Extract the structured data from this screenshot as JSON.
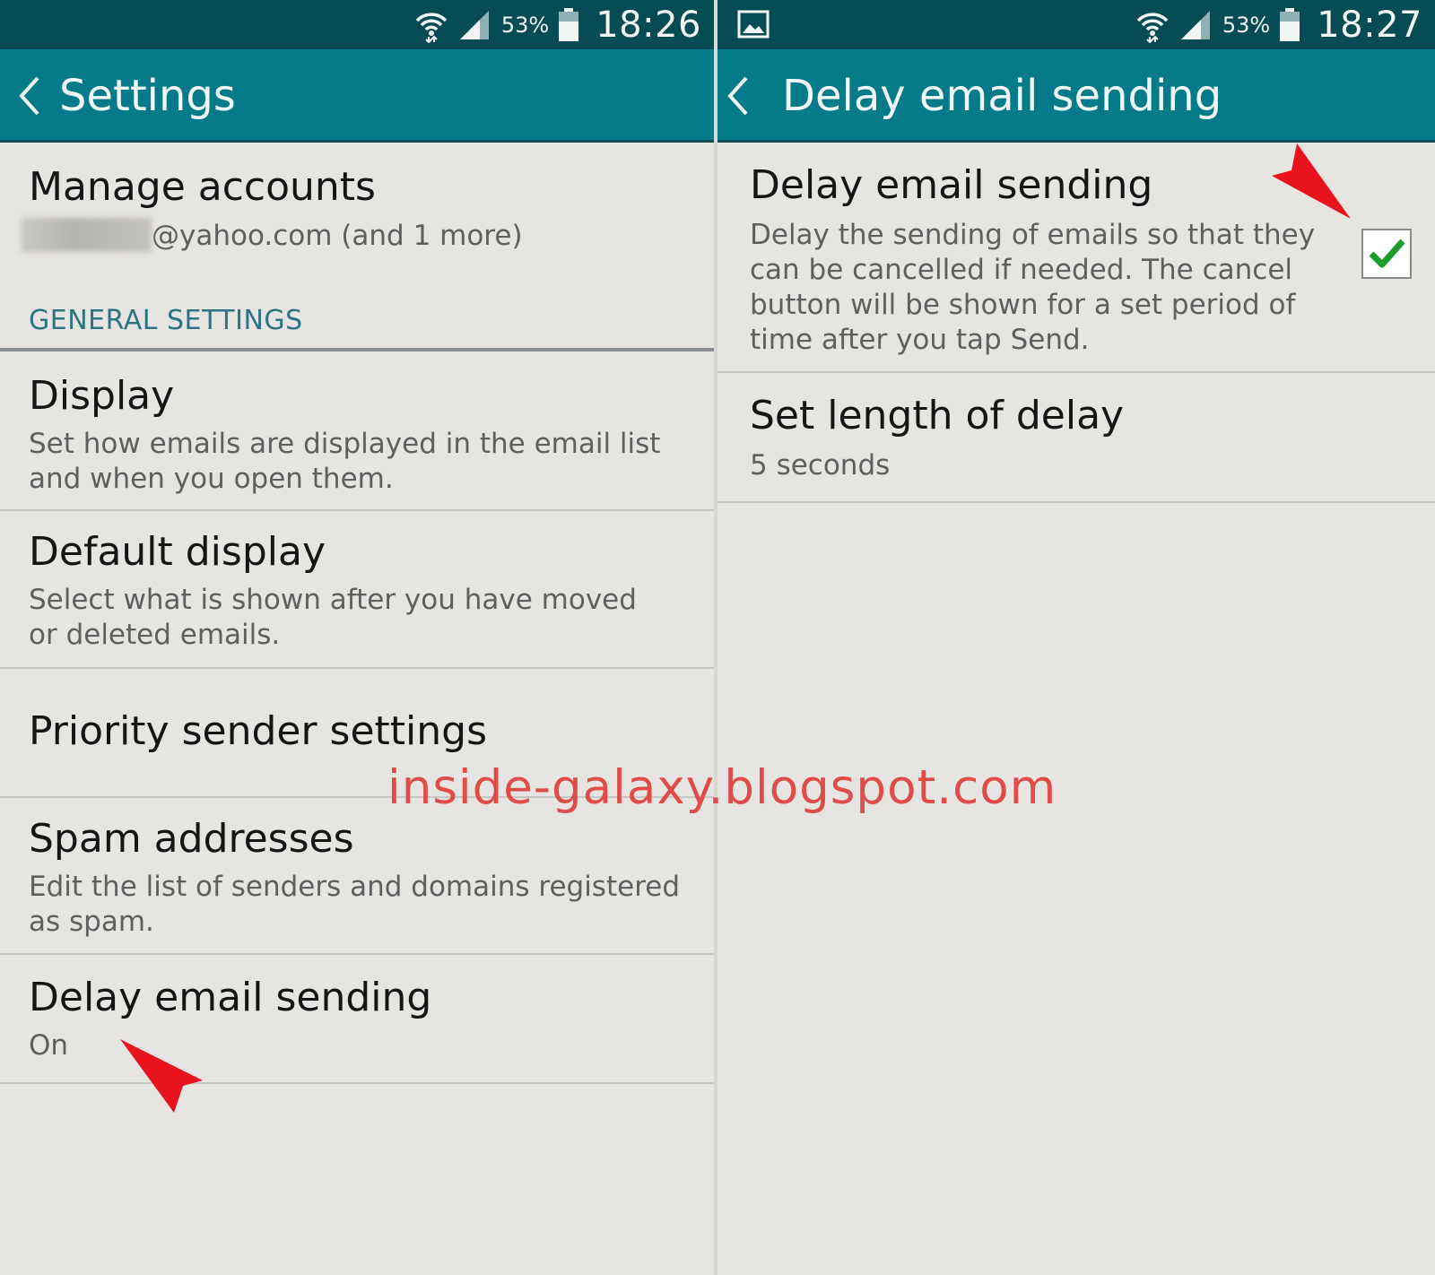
{
  "left_screen": {
    "status_bar": {
      "battery_percent": "53%",
      "time": "18:26"
    },
    "app_bar": {
      "title": "Settings"
    },
    "manage_accounts": {
      "title": "Manage accounts",
      "subtitle": "@yahoo.com (and 1 more)"
    },
    "section_header": "GENERAL SETTINGS",
    "items": [
      {
        "title": "Display",
        "subtitle": "Set how emails are displayed in the email list and when you open them."
      },
      {
        "title": "Default display",
        "subtitle": "Select what is shown after you have moved or deleted emails."
      },
      {
        "title": "Priority sender settings"
      },
      {
        "title": "Spam addresses",
        "subtitle": "Edit the list of senders and domains registered as spam."
      },
      {
        "title": "Delay email sending",
        "subtitle": "On"
      }
    ]
  },
  "right_screen": {
    "status_bar": {
      "battery_percent": "53%",
      "time": "18:27"
    },
    "app_bar": {
      "title": "Delay email sending"
    },
    "items": [
      {
        "title": "Delay email sending",
        "subtitle": "Delay the sending of emails so that they can be cancelled if needed. The cancel button will be shown for a set period of time after you tap Send.",
        "checked": true
      },
      {
        "title": "Set length of delay",
        "subtitle": "5 seconds"
      }
    ]
  },
  "watermark": "inside-galaxy.blogspot.com",
  "colors": {
    "status_bar": "#074b55",
    "app_bar": "#057b8a",
    "background": "#e7e5e2",
    "section_header": "#2e7480",
    "checkmark": "#1e9d2a",
    "annotation_arrow": "#e8131c"
  }
}
